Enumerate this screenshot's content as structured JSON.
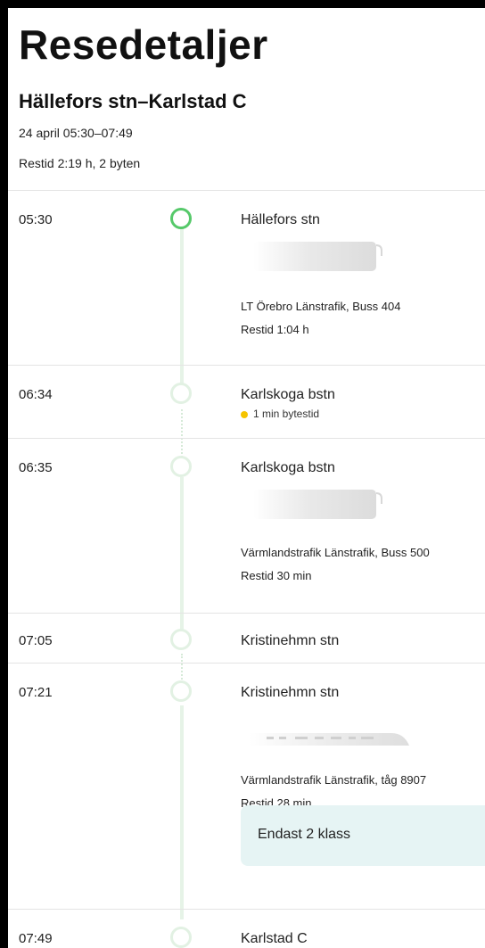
{
  "header": {
    "title": "Resedetaljer",
    "route": "Hällefors stn–Karlstad C",
    "date": "24 april 05:30–07:49",
    "duration": "Restid 2:19 h, 2 byten"
  },
  "stops": [
    {
      "time": "05:30",
      "station": "Hällefors stn",
      "operator": "LT Örebro Länstrafik, Buss 404",
      "travel_time": "Restid 1:04 h",
      "vehicle": "bus-icon"
    },
    {
      "time": "06:34",
      "station": "Karlskoga bstn",
      "transfer": "1 min bytestid"
    },
    {
      "time": "06:35",
      "station": "Karlskoga bstn",
      "operator": "Värmlandstrafik Länstrafik, Buss 500",
      "travel_time": "Restid 30 min",
      "vehicle": "bus-icon"
    },
    {
      "time": "07:05",
      "station": "Kristinehmn stn"
    },
    {
      "time": "07:21",
      "station": "Kristinehmn stn",
      "operator": "Värmlandstrafik Länstrafik, tåg 8907",
      "travel_time": "Restid 28 min",
      "vehicle": "train-icon",
      "notice": "Endast 2 klass"
    },
    {
      "time": "07:49",
      "station": "Karlstad C"
    }
  ],
  "colors": {
    "accent_green": "#56c96a",
    "line": "#e6f3e7",
    "transfer_dot": "#f5c400",
    "notice_bg": "#e6f4f4"
  }
}
